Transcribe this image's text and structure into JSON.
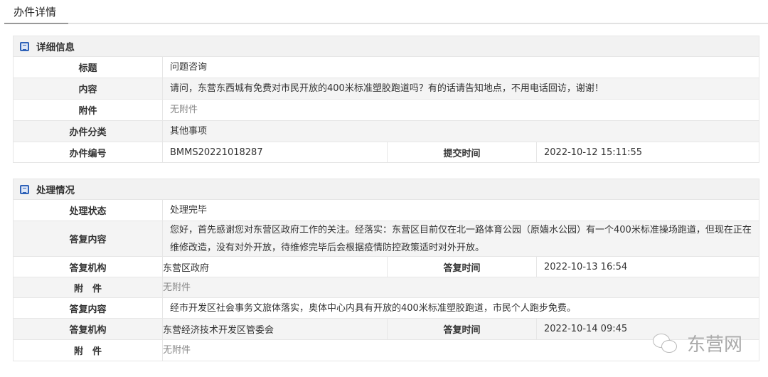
{
  "tab": "办件详情",
  "detail": {
    "title": "详细信息",
    "rows": [
      {
        "label": "标题",
        "value": "问题咨询"
      },
      {
        "label": "内容",
        "value": "请问，东营东西城有免费对市民开放的400米标准塑胶跑道吗？有的话请告知地点，不用电话回访，谢谢！"
      },
      {
        "label": "附件",
        "value": "无附件"
      },
      {
        "label": "办件分类",
        "value": "其他事项"
      },
      {
        "label": "办件编号",
        "value": "BMMS20221018287",
        "label2": "提交时间",
        "value2": "2022-10-12 15:11:55"
      }
    ]
  },
  "process": {
    "title": "处理情况",
    "rows": [
      {
        "label": "处理状态",
        "value": "处理完毕"
      },
      {
        "label": "答复内容",
        "value": "您好，首先感谢您对东营区政府工作的关注。经落实：东营区目前仅在北一路体育公园（原嫱水公园）有一个400米标准操场跑道，但现在正在维修改造，没有对外开放，待维修完毕后会根据疫情防控政策适时对外开放。"
      },
      {
        "label": "答复机构",
        "value": "东营区政府",
        "label2": "答复时间",
        "value2": "2022-10-13 16:54"
      },
      {
        "label": "附　件",
        "value": "无附件"
      },
      {
        "label": "答复内容",
        "value": "经市开发区社会事务文旅体落实，奥体中心内具有开放的400米标准塑胶跑道，市民个人跑步免费。"
      },
      {
        "label": "答复机构",
        "value": "东营经济技术开发区管委会",
        "label2": "答复时间",
        "value2": "2022-10-14 09:45"
      },
      {
        "label": "附　件",
        "value": "无附件"
      }
    ]
  },
  "watermark": "东营网"
}
